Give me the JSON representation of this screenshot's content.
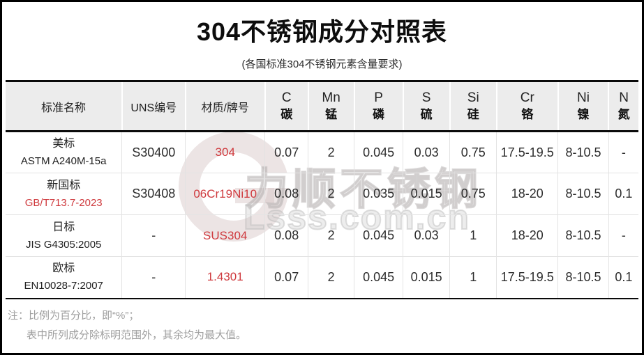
{
  "title": "304不锈钢成分对照表",
  "subtitle": "(各国标准304不锈钢元素含量要求)",
  "colors": {
    "accent_red": "#cf3a3e",
    "header_bg": "#ececec",
    "note_gray": "#9e9e9e",
    "border_black": "#0a0a0a",
    "watermark_gray": "#d9d4d4"
  },
  "table": {
    "headers": [
      {
        "label": "标准名称"
      },
      {
        "label": "UNS编号"
      },
      {
        "label": "材质/牌号"
      },
      {
        "symbol": "C",
        "cn": "碳"
      },
      {
        "symbol": "Mn",
        "cn": "锰"
      },
      {
        "symbol": "P",
        "cn": "磷"
      },
      {
        "symbol": "S",
        "cn": "硫"
      },
      {
        "symbol": "Si",
        "cn": "硅"
      },
      {
        "symbol": "Cr",
        "cn": "铬"
      },
      {
        "symbol": "Ni",
        "cn": "镍"
      },
      {
        "symbol": "N",
        "cn": "氮"
      }
    ],
    "rows": [
      {
        "standard_name": "美标",
        "standard_code": "ASTM A240M-15a",
        "uns": "S30400",
        "grade": "304",
        "values": [
          "0.07",
          "2",
          "0.045",
          "0.03",
          "0.75",
          "17.5-19.5",
          "8-10.5",
          "-"
        ]
      },
      {
        "standard_name": "新国标",
        "standard_code": "GB/T713.7-2023",
        "uns": "S30408",
        "grade": "06Cr19Ni10",
        "values": [
          "0.08",
          "2",
          "0.035",
          "0.015",
          "0.75",
          "18-20",
          "8-10.5",
          "0.1"
        ]
      },
      {
        "standard_name": "日标",
        "standard_code": "JIS G4305:2005",
        "uns": "-",
        "grade": "SUS304",
        "values": [
          "0.08",
          "2",
          "0.045",
          "0.03",
          "1",
          "18-20",
          "8-10.5",
          "-"
        ]
      },
      {
        "standard_name": "欧标",
        "standard_code": "EN10028-7:2007",
        "uns": "-",
        "grade": "1.4301",
        "values": [
          "0.07",
          "2",
          "0.045",
          "0.015",
          "1",
          "17.5-19.5",
          "8-10.5",
          "0.1"
        ]
      }
    ]
  },
  "notes": {
    "line1": "注：比例为百分比，即“%”；",
    "line2": "表中所列成分除标明范围外，其余均为最大值。"
  },
  "watermark": {
    "logo": "lsss-g-logo",
    "text": "力顺不锈钢",
    "url": "Lsss.com.cn"
  }
}
